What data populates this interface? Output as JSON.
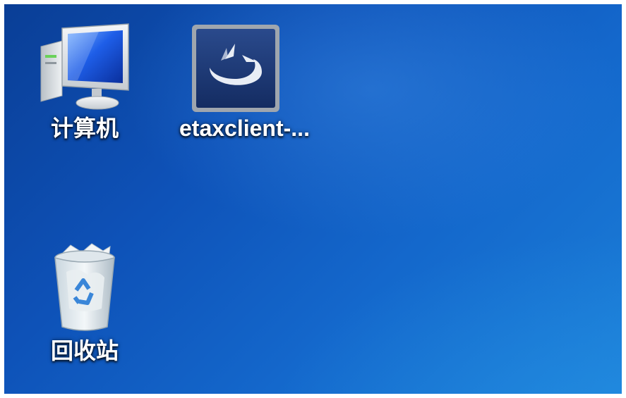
{
  "desktop": {
    "icons": [
      {
        "label": "计算机",
        "icon": "computer-icon"
      },
      {
        "label": "etaxclient-...",
        "icon": "etaxclient-app-icon"
      },
      {
        "label": "回收站",
        "icon": "recycle-bin-icon"
      }
    ]
  },
  "colors": {
    "desktop_blue_dark": "#0a3e96",
    "desktop_blue_light": "#1b7fd8",
    "label_text": "#ffffff",
    "app_icon_bg": "#1c3a78"
  }
}
